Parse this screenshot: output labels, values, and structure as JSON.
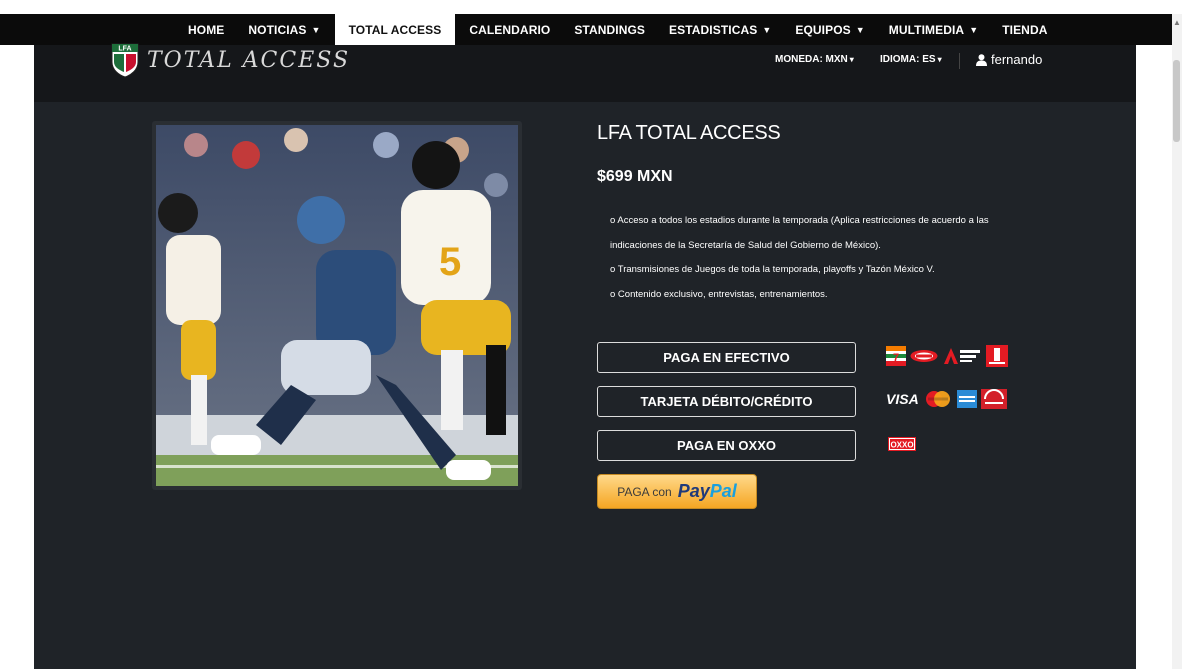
{
  "nav": {
    "items": [
      {
        "label": "HOME",
        "dropdown": false,
        "active": false
      },
      {
        "label": "NOTICIAS",
        "dropdown": true,
        "active": false
      },
      {
        "label": "TOTAL ACCESS",
        "dropdown": false,
        "active": true
      },
      {
        "label": "CALENDARIO",
        "dropdown": false,
        "active": false
      },
      {
        "label": "STANDINGS",
        "dropdown": false,
        "active": false
      },
      {
        "label": "ESTADISTICAS",
        "dropdown": true,
        "active": false
      },
      {
        "label": "EQUIPOS",
        "dropdown": true,
        "active": false
      },
      {
        "label": "MULTIMEDIA",
        "dropdown": true,
        "active": false
      },
      {
        "label": "TIENDA",
        "dropdown": false,
        "active": false
      }
    ]
  },
  "header": {
    "logo_badge_text": "LFA",
    "logo_text": "TOTAL ACCESS",
    "currency_label": "MONEDA: MXN",
    "language_label": "IDIOMA: ES",
    "user_name": "fernando"
  },
  "product": {
    "title": "LFA TOTAL ACCESS",
    "price": "$699 MXN",
    "features": [
      "o Acceso a todos los estadios durante la temporada (Aplica restricciones de acuerdo a las",
      "indicaciones de la Secretaría de Salud del Gobierno de México).",
      "o Transmisiones de Juegos de toda la temporada, playoffs y Tazón México V.",
      "o Contenido exclusivo, entrevistas, entrenamientos."
    ]
  },
  "payment": {
    "cash_label": "PAGA EN EFECTIVO",
    "card_label": "TARJETA DÉBITO/CRÉDITO",
    "oxxo_label": "PAGA EN OXXO",
    "paypal_prefix": "PAGA con",
    "paypal_logo_pay": "Pay",
    "paypal_logo_pal": "Pal",
    "card_brand_visa": "VISA",
    "oxxo_brand": "OXXO"
  },
  "colors": {
    "nav_bg": "#0b0b0b",
    "panel_bg": "#1f2328",
    "header_bg": "#15171a",
    "paypal_gold": "#f5a623",
    "paypal_blue": "#1f3a7a",
    "paypal_light_blue": "#1aa0de"
  }
}
